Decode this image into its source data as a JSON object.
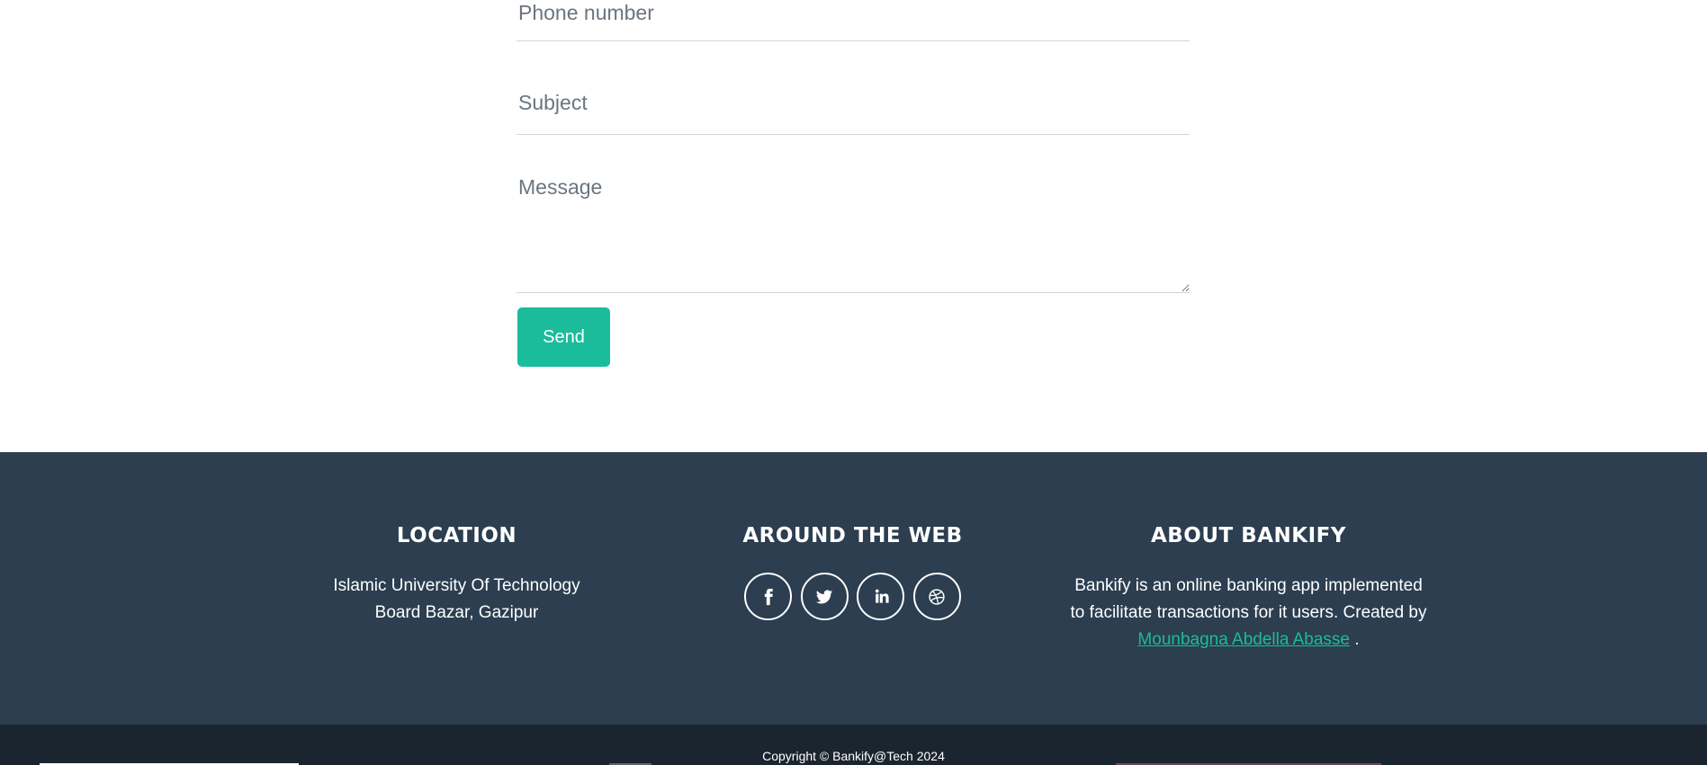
{
  "contact_form": {
    "phone_placeholder": "Phone number",
    "subject_placeholder": "Subject",
    "message_placeholder": "Message",
    "send_label": "Send"
  },
  "footer": {
    "location": {
      "title": "LOCATION",
      "line1": "Islamic University Of Technology",
      "line2": "Board Bazar, Gazipur"
    },
    "web": {
      "title": "AROUND THE WEB",
      "icons": [
        "facebook-icon",
        "twitter-icon",
        "linkedin-icon",
        "dribbble-icon"
      ]
    },
    "about": {
      "title": "ABOUT BANKIFY",
      "text_line1": "Bankify is an online banking app implemented",
      "text_line2": "to facilitate transactions for it users. Created by",
      "author": "Mounbagna Abdella Abasse",
      "after_author": " ."
    }
  },
  "copyright": {
    "text": "Copyright © Bankify@Tech 2024"
  },
  "colors": {
    "accent": "#1abc9c",
    "footer_bg": "#2c3e50",
    "copyright_bg": "#1a252f"
  }
}
